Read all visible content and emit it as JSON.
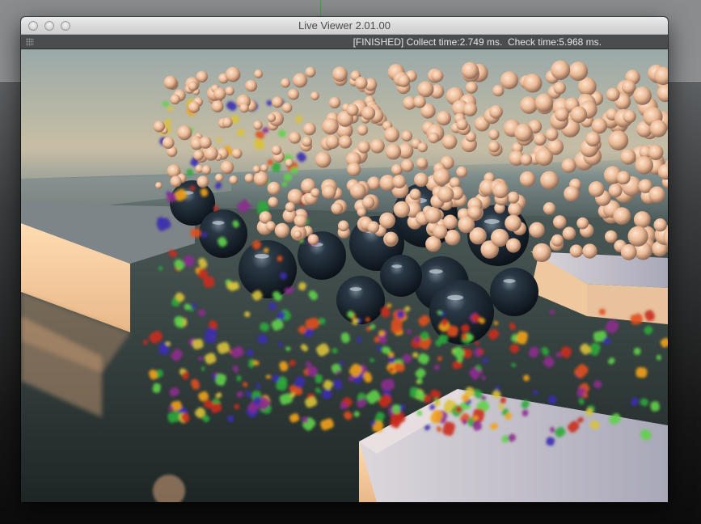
{
  "window": {
    "title": "Live Viewer 2.01.00",
    "status": "[FINISHED] Collect time:2.749 ms.  Check time:5.968 ms."
  },
  "colors": {
    "sphere_light": "#f3c7a5",
    "sphere_shadow": "#c79373",
    "dark_ball": "#151d25",
    "wall_top": "#c9c7d2",
    "wall_front": "#f7cfa3",
    "floor": "#2a3433",
    "confetti": [
      "#2ea83a",
      "#e0501c",
      "#f2a21a",
      "#3b2fb0",
      "#8d2b8e",
      "#5fd24a",
      "#d9c23a",
      "#c92b1e"
    ]
  },
  "icons": {
    "traffic_lights": [
      "close-icon",
      "minimize-icon",
      "zoom-icon"
    ],
    "grip": "grip-dots-icon"
  }
}
